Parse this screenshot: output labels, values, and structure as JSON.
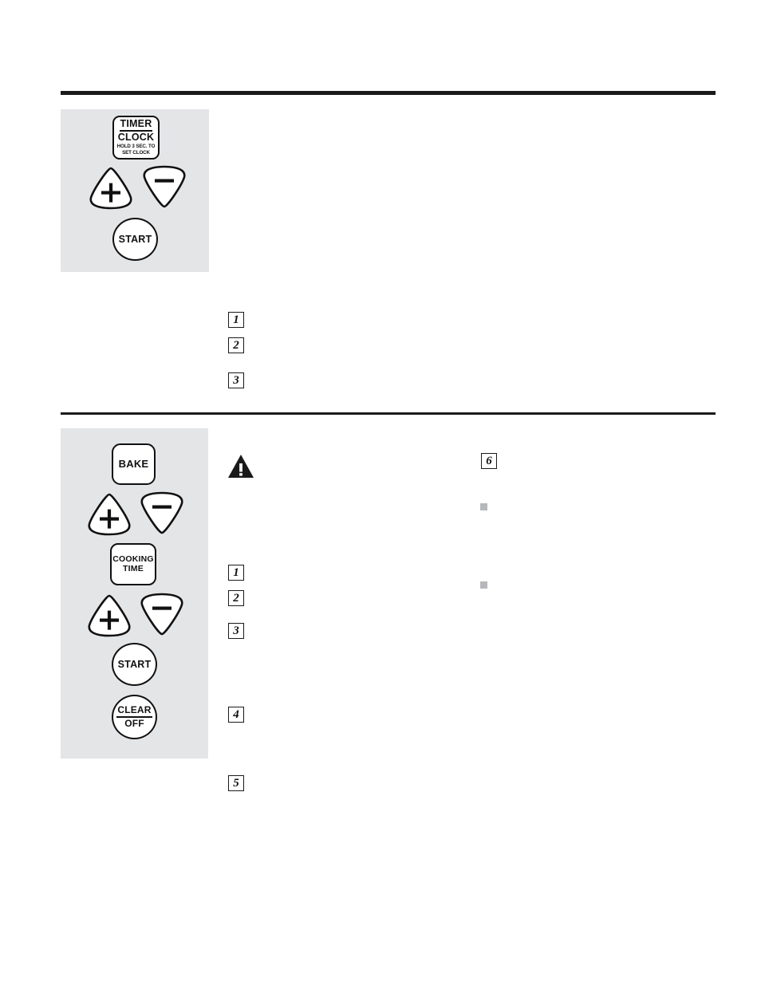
{
  "document": {
    "type": "appliance-control-panel-instructions",
    "background_color": "#ffffff",
    "panel_fill": "#e4e5e7",
    "ink_color": "#111111",
    "bullet_color": "#b6b8bb"
  },
  "dividers": [
    {
      "name": "top-rule",
      "weight": "thick"
    },
    {
      "name": "middle-rule",
      "weight": "thin"
    }
  ],
  "sections": [
    {
      "id": "timer-section",
      "panel": {
        "name": "timer-control-panel",
        "buttons": [
          {
            "name": "timer-clock-button",
            "shape": "rounded-square",
            "line1": "TIMER",
            "line2": "CLOCK",
            "line3": "HOLD 3 SEC. TO",
            "line4": "SET CLOCK"
          },
          {
            "name": "plus-button",
            "shape": "triangle-up",
            "glyph": "+"
          },
          {
            "name": "minus-button",
            "shape": "triangle-down",
            "glyph": "−"
          },
          {
            "name": "start-button",
            "shape": "circle",
            "label": "START"
          }
        ]
      },
      "steps": [
        {
          "number": "1"
        },
        {
          "number": "2"
        },
        {
          "number": "3"
        }
      ]
    },
    {
      "id": "bake-section",
      "panel": {
        "name": "bake-control-panel",
        "buttons": [
          {
            "name": "bake-button",
            "shape": "rounded-square",
            "label": "BAKE"
          },
          {
            "name": "plus-button",
            "shape": "triangle-up",
            "glyph": "+"
          },
          {
            "name": "minus-button",
            "shape": "triangle-down",
            "glyph": "−"
          },
          {
            "name": "cooking-time-button",
            "shape": "rounded-square",
            "line1": "COOKING",
            "line2": "TIME"
          },
          {
            "name": "plus-button-2",
            "shape": "triangle-up",
            "glyph": "+"
          },
          {
            "name": "minus-button-2",
            "shape": "triangle-down",
            "glyph": "−"
          },
          {
            "name": "start-button",
            "shape": "circle",
            "label": "START"
          },
          {
            "name": "clear-off-button",
            "shape": "circle",
            "line1": "CLEAR",
            "line2": "OFF"
          }
        ]
      },
      "warning": {
        "name": "warning-triangle-icon",
        "glyph": "!"
      },
      "steps": [
        {
          "number": "1"
        },
        {
          "number": "2"
        },
        {
          "number": "3"
        },
        {
          "number": "4"
        },
        {
          "number": "5"
        },
        {
          "number": "6"
        }
      ],
      "bullets": [
        {
          "name": "square-bullet-1"
        },
        {
          "name": "square-bullet-2"
        }
      ]
    }
  ]
}
